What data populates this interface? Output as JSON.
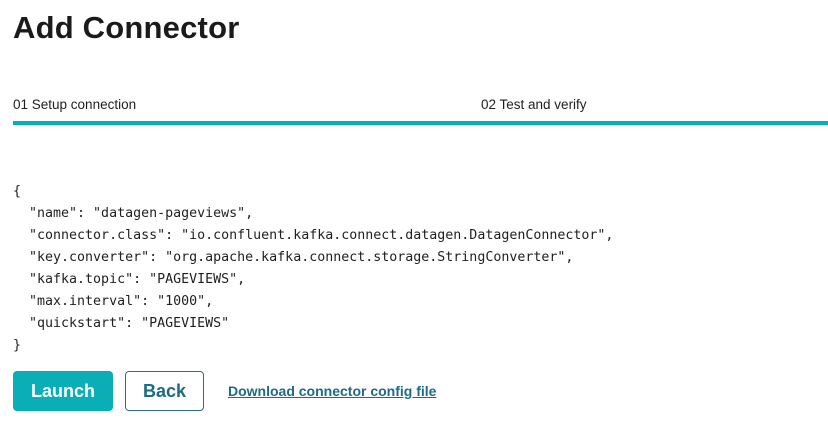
{
  "page": {
    "title": "Add Connector"
  },
  "steps": [
    {
      "label": "01 Setup connection"
    },
    {
      "label": "02 Test and verify"
    }
  ],
  "config": {
    "code_lines": [
      "{",
      "  \"name\": \"datagen-pageviews\",",
      "  \"connector.class\": \"io.confluent.kafka.connect.datagen.DatagenConnector\",",
      "  \"key.converter\": \"org.apache.kafka.connect.storage.StringConverter\",",
      "  \"kafka.topic\": \"PAGEVIEWS\",",
      "  \"max.interval\": \"1000\",",
      "  \"quickstart\": \"PAGEVIEWS\"",
      "}"
    ]
  },
  "actions": {
    "launch_label": "Launch",
    "back_label": "Back",
    "download_label": "Download connector config file"
  },
  "colors": {
    "accent": "#08aeb8",
    "link": "#1c6a85"
  }
}
